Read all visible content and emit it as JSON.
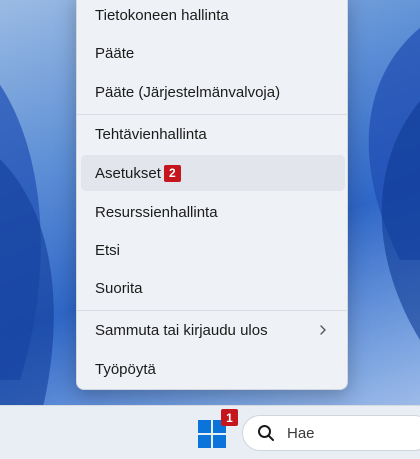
{
  "context_menu": {
    "items": [
      {
        "label": "Tietokoneen hallinta"
      },
      {
        "label": "Pääte"
      },
      {
        "label": "Pääte (Järjestelmänvalvoja)"
      },
      {
        "label": "Tehtävienhallinta"
      },
      {
        "label": "Asetukset",
        "badge": "2"
      },
      {
        "label": "Resurssienhallinta"
      },
      {
        "label": "Etsi"
      },
      {
        "label": "Suorita"
      },
      {
        "label": "Sammuta tai kirjaudu ulos",
        "icon": "chevron-right-icon"
      },
      {
        "label": "Työpöytä"
      }
    ]
  },
  "taskbar": {
    "start_badge": "1",
    "search_placeholder": "Hae",
    "start_icon": "windows-logo-icon",
    "search_icon": "search-icon"
  },
  "colors": {
    "badge": "#c4161c",
    "windows_logo": "#0a74da",
    "menu_background": "#eef1f5"
  }
}
